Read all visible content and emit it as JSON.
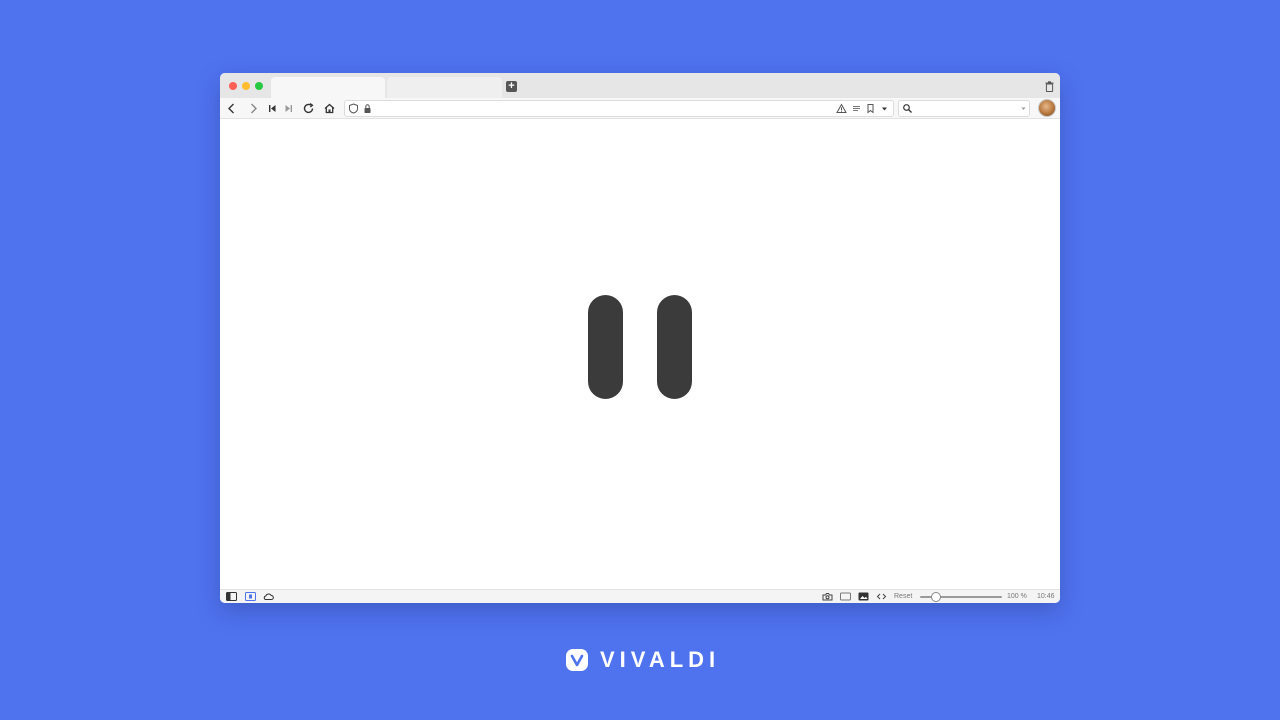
{
  "browser": {
    "tabs": [
      {
        "label": "",
        "state": "active"
      },
      {
        "label": "",
        "state": "inactive"
      }
    ],
    "address_bar": {
      "url": "",
      "search_placeholder": ""
    },
    "status_bar": {
      "zoom_reset_label": "Reset",
      "zoom_level_text": "100 %",
      "zoom_level": 100,
      "clock": "10:46"
    }
  },
  "content": {
    "media_state": "paused",
    "icon": "pause-icon",
    "icon_color": "#3b3b3b"
  },
  "brand": {
    "name": "VIVALDI",
    "logo_icon": "vivaldi-logo-icon"
  },
  "colors": {
    "background": "#4f72ef",
    "window": "#ffffff",
    "toolbar": "#f7f7f7",
    "tabbar": "#e6e6e6"
  }
}
